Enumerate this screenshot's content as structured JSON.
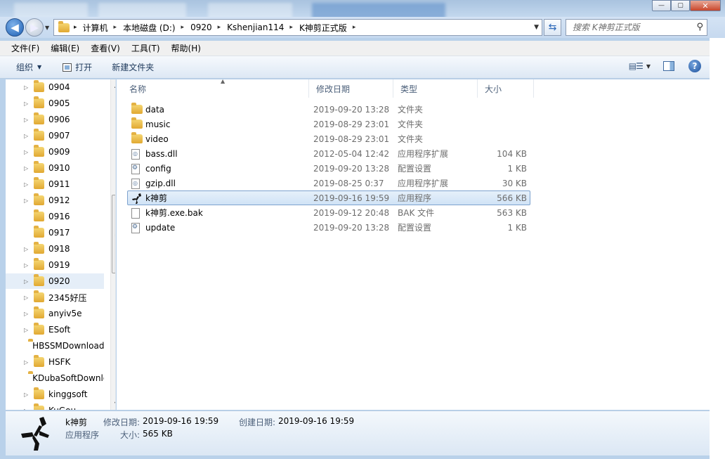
{
  "window": {
    "blur_tabs": [
      "",
      "",
      "",
      ""
    ],
    "controls": {
      "minimize": "—",
      "maximize": "▢",
      "close": "✕"
    }
  },
  "address": {
    "crumbs": [
      "计算机",
      "本地磁盘 (D:)",
      "0920",
      "Kshenjian114",
      "K神剪正式版"
    ],
    "separator": "▸",
    "search_placeholder": "搜索 K神剪正式版"
  },
  "menu": [
    "文件(F)",
    "编辑(E)",
    "查看(V)",
    "工具(T)",
    "帮助(H)"
  ],
  "toolbar": {
    "organize": "组织",
    "open": "打开",
    "new_folder": "新建文件夹",
    "help": "?"
  },
  "tree": [
    {
      "label": "0904",
      "arrow": true,
      "selected": false
    },
    {
      "label": "0905",
      "arrow": true,
      "selected": false
    },
    {
      "label": "0906",
      "arrow": true,
      "selected": false
    },
    {
      "label": "0907",
      "arrow": true,
      "selected": false
    },
    {
      "label": "0909",
      "arrow": true,
      "selected": false
    },
    {
      "label": "0910",
      "arrow": true,
      "selected": false
    },
    {
      "label": "0911",
      "arrow": true,
      "selected": false
    },
    {
      "label": "0912",
      "arrow": true,
      "selected": false
    },
    {
      "label": "0916",
      "arrow": false,
      "selected": false
    },
    {
      "label": "0917",
      "arrow": false,
      "selected": false
    },
    {
      "label": "0918",
      "arrow": true,
      "selected": false
    },
    {
      "label": "0919",
      "arrow": true,
      "selected": false
    },
    {
      "label": "0920",
      "arrow": true,
      "selected": true
    },
    {
      "label": "2345好压",
      "arrow": true,
      "selected": false
    },
    {
      "label": "anyiv5e",
      "arrow": true,
      "selected": false
    },
    {
      "label": "ESoft",
      "arrow": true,
      "selected": false
    },
    {
      "label": "HBSSMDownload",
      "arrow": false,
      "selected": false
    },
    {
      "label": "HSFK",
      "arrow": true,
      "selected": false
    },
    {
      "label": "KDubaSoftDownloads",
      "arrow": false,
      "selected": false
    },
    {
      "label": "kinggsoft",
      "arrow": true,
      "selected": false
    },
    {
      "label": "KuGou",
      "arrow": true,
      "selected": false
    }
  ],
  "columns": {
    "name": "名称",
    "date": "修改日期",
    "type": "类型",
    "size": "大小"
  },
  "files": [
    {
      "name": "data",
      "date": "2019-09-20 13:28",
      "type": "文件夹",
      "size": "",
      "icon": "folder",
      "selected": false
    },
    {
      "name": "music",
      "date": "2019-08-29 23:01",
      "type": "文件夹",
      "size": "",
      "icon": "folder",
      "selected": false
    },
    {
      "name": "video",
      "date": "2019-08-29 23:01",
      "type": "文件夹",
      "size": "",
      "icon": "folder",
      "selected": false
    },
    {
      "name": "bass.dll",
      "date": "2012-05-04 12:42",
      "type": "应用程序扩展",
      "size": "104 KB",
      "icon": "dll",
      "selected": false
    },
    {
      "name": "config",
      "date": "2019-09-20 13:28",
      "type": "配置设置",
      "size": "1 KB",
      "icon": "gear",
      "selected": false
    },
    {
      "name": "gzip.dll",
      "date": "2019-08-25 0:37",
      "type": "应用程序扩展",
      "size": "30 KB",
      "icon": "dll",
      "selected": false
    },
    {
      "name": "k神剪",
      "date": "2019-09-16 19:59",
      "type": "应用程序",
      "size": "566 KB",
      "icon": "app",
      "selected": true
    },
    {
      "name": "k神剪.exe.bak",
      "date": "2019-09-12 20:48",
      "type": "BAK 文件",
      "size": "563 KB",
      "icon": "blank",
      "selected": false
    },
    {
      "name": "update",
      "date": "2019-09-20 13:28",
      "type": "配置设置",
      "size": "1 KB",
      "icon": "gear",
      "selected": false
    }
  ],
  "details": {
    "name": "k神剪",
    "kind": "应用程序",
    "modified_label": "修改日期:",
    "modified_value": "2019-09-16 19:59",
    "created_label": "创建日期:",
    "created_value": "2019-09-16 19:59",
    "size_label": "大小:",
    "size_value": "565 KB"
  }
}
